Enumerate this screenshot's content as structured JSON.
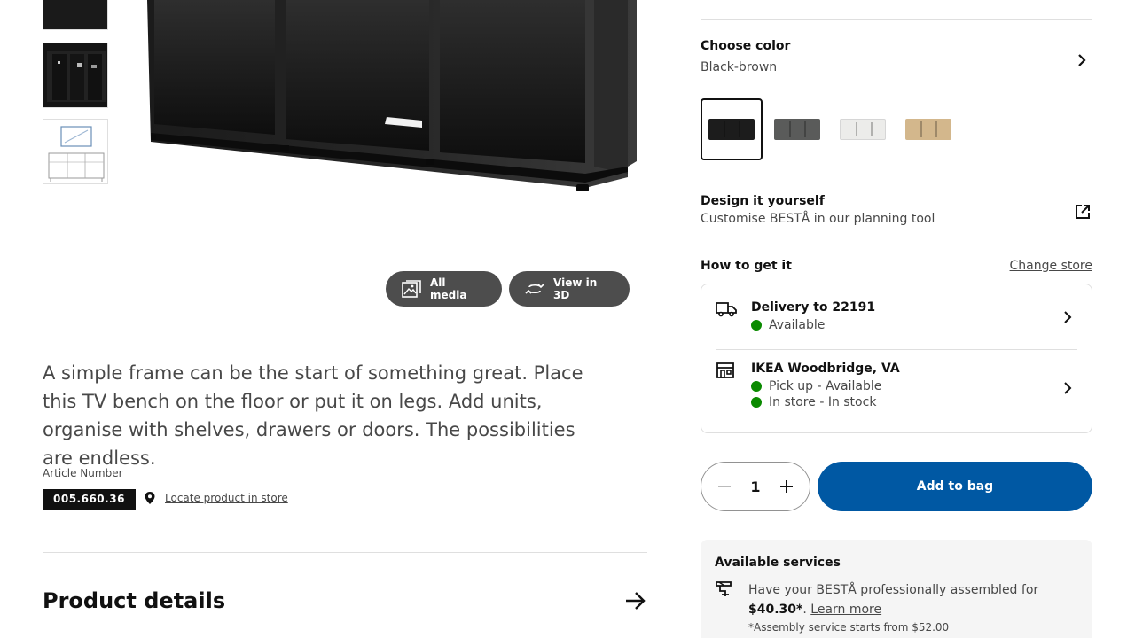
{
  "gallery": {
    "media_buttons": {
      "all_media": "All media",
      "view_3d": "View in 3D"
    }
  },
  "product": {
    "description": "A simple frame can be the start of something great. Place this TV bench on the floor or put it on legs. Add units, organise with shelves, drawers or doors. The possibilities are endless.",
    "article_label": "Article Number",
    "article_number": "005.660.36",
    "locate_link": "Locate product in store",
    "details_heading": "Product details"
  },
  "color": {
    "label": "Choose color",
    "selected": "Black-brown",
    "swatches": [
      {
        "name": "Black-brown",
        "color": "#1c1c1c"
      },
      {
        "name": "Dark grey",
        "color": "#5a5b5a"
      },
      {
        "name": "White",
        "color": "#ececea"
      },
      {
        "name": "Oak effect",
        "color": "#d3b78c"
      }
    ]
  },
  "design": {
    "title": "Design it yourself",
    "subtitle": "Customise BESTÅ in our planning tool"
  },
  "fulfilment": {
    "heading": "How to get it",
    "change_store": "Change store",
    "delivery": {
      "title": "Delivery to 22191",
      "status": "Available"
    },
    "store": {
      "title": "IKEA Woodbridge, VA",
      "pickup": "Pick up - Available",
      "instore": "In store - In stock"
    },
    "status_color": "#0a8a00"
  },
  "purchase": {
    "quantity": "1",
    "add_to_bag": "Add to bag",
    "accent": "#0058a3"
  },
  "services": {
    "title": "Available services",
    "text_prefix": "Have your BESTÅ professionally assembled for ",
    "price": "$40.30*",
    "text_mid": ". ",
    "learn_more": "Learn more",
    "note": "*Assembly service starts from $52.00"
  }
}
